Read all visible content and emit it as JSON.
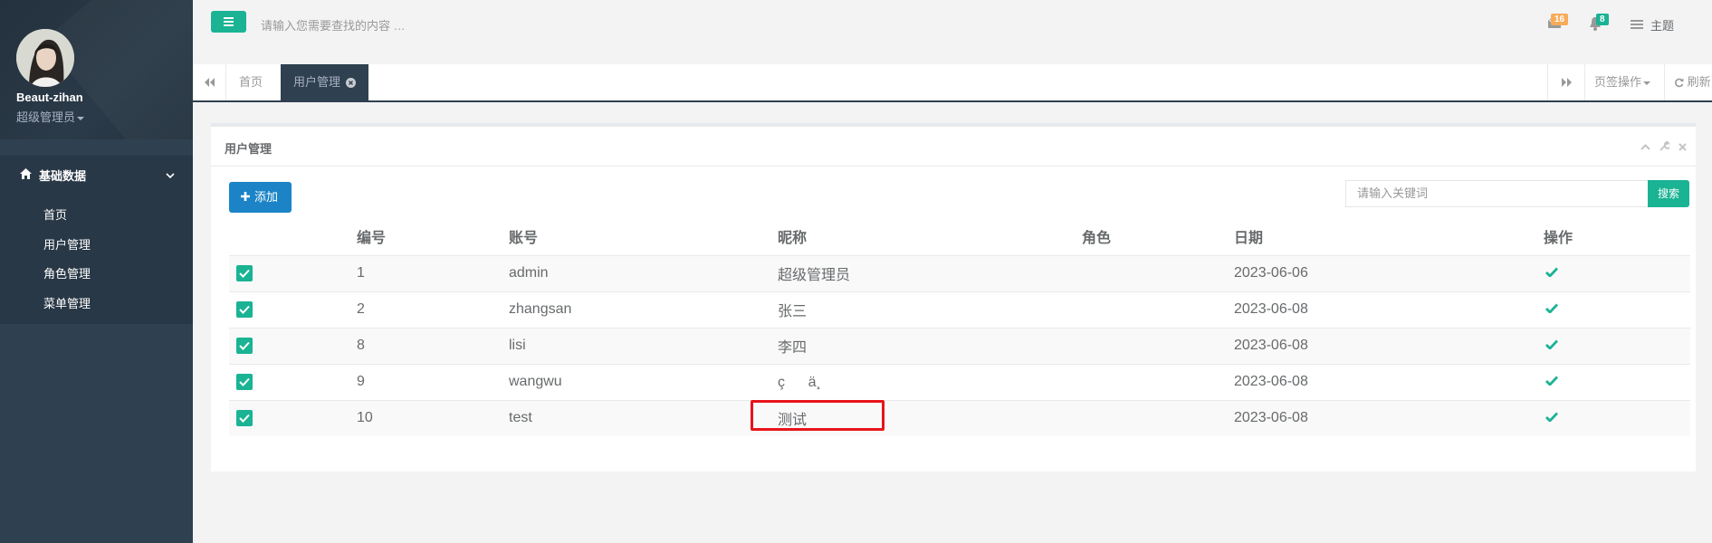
{
  "sidebar": {
    "user_name": "Beaut-zihan",
    "user_role": "超级管理员",
    "menu_group": "基础数据",
    "items": [
      {
        "label": "首页"
      },
      {
        "label": "用户管理"
      },
      {
        "label": "角色管理"
      },
      {
        "label": "菜单管理"
      }
    ]
  },
  "topbar": {
    "search_placeholder": "请输入您需要查找的内容 …",
    "mail_count": "16",
    "bell_count": "8",
    "theme_label": "主题"
  },
  "tabs": {
    "items": [
      {
        "label": "首页"
      },
      {
        "label": "用户管理"
      }
    ],
    "ops_label": "页签操作",
    "refresh_label": "刷新"
  },
  "panel": {
    "title": "用户管理",
    "add_label": "添加",
    "search_placeholder": "请输入关键词",
    "search_button": "搜索"
  },
  "table": {
    "headers": [
      "编号",
      "账号",
      "昵称",
      "角色",
      "日期",
      "操作"
    ],
    "rows": [
      {
        "id": "1",
        "account": "admin",
        "nickname": "超级管理员",
        "role": "",
        "date": "2023-06-06"
      },
      {
        "id": "2",
        "account": "zhangsan",
        "nickname": "张三",
        "role": "",
        "date": "2023-06-08"
      },
      {
        "id": "8",
        "account": "lisi",
        "nickname": "李四",
        "role": "",
        "date": "2023-06-08"
      },
      {
        "id": "9",
        "account": "wangwu",
        "nickname": "çä¸",
        "role": "",
        "date": "2023-06-08"
      },
      {
        "id": "10",
        "account": "test",
        "nickname": "测试",
        "role": "",
        "date": "2023-06-08"
      }
    ]
  },
  "colors": {
    "sidebar_bg": "#2f4050",
    "primary_green": "#1ab394",
    "primary_blue": "#1c84c6",
    "badge_orange": "#f8ac59",
    "highlight_red": "#e8141b"
  }
}
